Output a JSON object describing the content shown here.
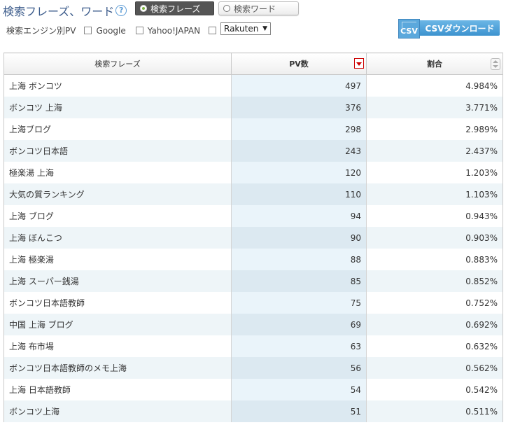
{
  "header": {
    "title": "検索フレーズ、ワード",
    "mode_phrase": "検索フレーズ",
    "mode_word": "検索ワード"
  },
  "filters": {
    "label": "検索エンジン別PV",
    "google": "Google",
    "yahoo": "Yahoo!JAPAN",
    "select_value": "Rakuten"
  },
  "csv": {
    "icon_text": "CSV",
    "label": "CSVダウンロード"
  },
  "table": {
    "headers": [
      "検索フレーズ",
      "PV数",
      "割合"
    ],
    "rows": [
      [
        "上海 ボンコツ",
        "497",
        "4.984%"
      ],
      [
        "ボンコツ 上海",
        "376",
        "3.771%"
      ],
      [
        "上海ブログ",
        "298",
        "2.989%"
      ],
      [
        "ボンコツ日本語",
        "243",
        "2.437%"
      ],
      [
        "極楽湯 上海",
        "120",
        "1.203%"
      ],
      [
        "大気の質ランキング",
        "110",
        "1.103%"
      ],
      [
        "上海 ブログ",
        "94",
        "0.943%"
      ],
      [
        "上海 ぼんこつ",
        "90",
        "0.903%"
      ],
      [
        "上海 極楽湯",
        "88",
        "0.883%"
      ],
      [
        "上海 スーパー銭湯",
        "85",
        "0.852%"
      ],
      [
        "ボンコツ日本語教師",
        "75",
        "0.752%"
      ],
      [
        "中国 上海 ブログ",
        "69",
        "0.692%"
      ],
      [
        "上海 布市場",
        "63",
        "0.632%"
      ],
      [
        "ボンコツ日本語教師のメモ上海",
        "56",
        "0.562%"
      ],
      [
        "上海 日本語教師",
        "54",
        "0.542%"
      ],
      [
        "ボンコツ上海",
        "51",
        "0.511%"
      ]
    ]
  }
}
